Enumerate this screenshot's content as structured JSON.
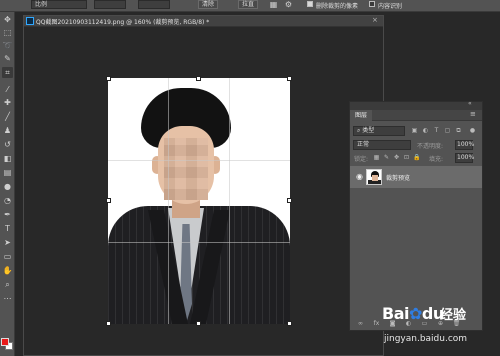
{
  "options_bar": {
    "ratio_label": "比例",
    "clear_label": "清除",
    "straighten_label": "拉直",
    "delete_cropped_label": "删除裁剪的像素",
    "delete_cropped_checked": true,
    "content_aware_label": "内容识别",
    "content_aware_checked": false
  },
  "document": {
    "tab_title": "QQ截图20210903112419.png @ 160% (裁剪预览, RGB/8) *",
    "close_glyph": "×"
  },
  "tools": [
    "move",
    "marquee",
    "lasso",
    "quick-select",
    "crop",
    "eyedropper",
    "healing",
    "brush",
    "clone-stamp",
    "history-brush",
    "eraser",
    "gradient",
    "blur",
    "dodge",
    "pen",
    "type",
    "path-select",
    "shape",
    "hand",
    "zoom",
    "more"
  ],
  "colors": {
    "foreground": "#e81a1a",
    "background": "#ffffff",
    "accent": "#31a8ff"
  },
  "layers_panel": {
    "tab_label": "图层",
    "filter_placeholder": "类型",
    "blend_mode": "正常",
    "opacity_label": "不透明度:",
    "opacity_value": "100%",
    "lock_label": "锁定:",
    "fill_label": "填充:",
    "fill_value": "100%",
    "layers": [
      {
        "name": "裁剪预览",
        "visible": true
      }
    ]
  },
  "watermark": {
    "logo_text_a": "Bai",
    "logo_text_b": "du",
    "logo_jingyan": "经验",
    "url": "jingyan.baidu.com"
  }
}
